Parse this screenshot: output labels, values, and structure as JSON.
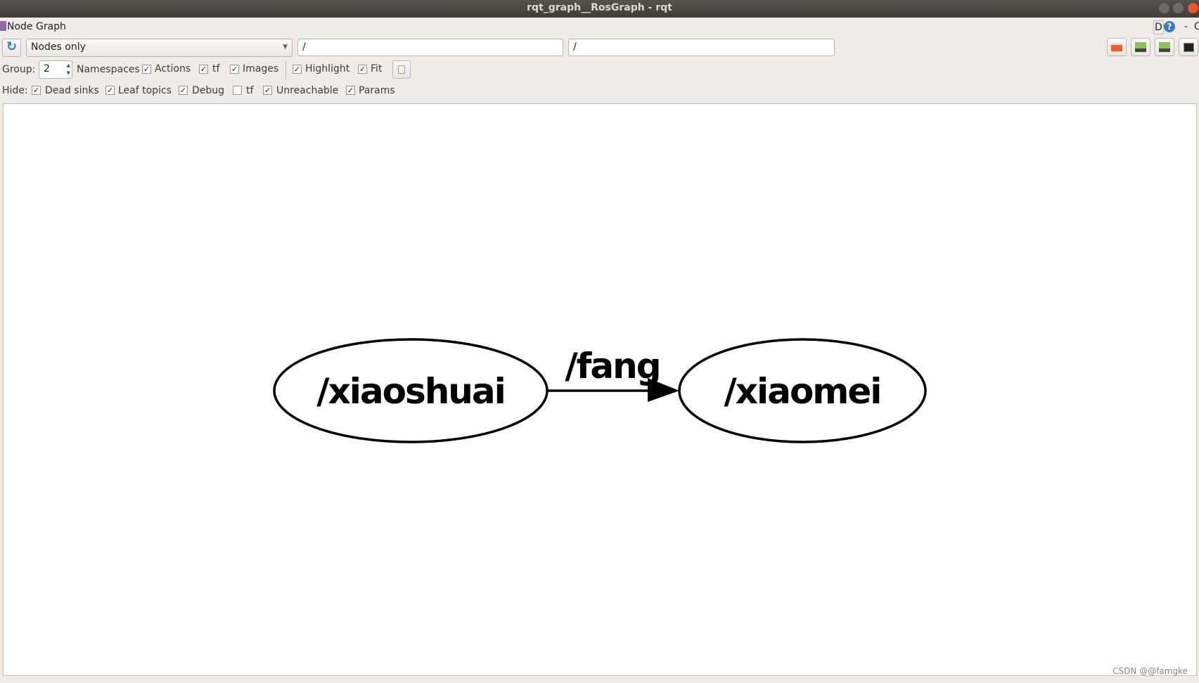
{
  "window": {
    "title": "rqt_graph__RosGraph - rqt"
  },
  "plugin": {
    "title": "Node Graph",
    "d_label": "D",
    "help_icon": "help-icon",
    "minus_label": "-",
    "o_label": "O"
  },
  "toolbar": {
    "refresh_icon": "refresh-icon",
    "mode": "Nodes only",
    "filter1": "/",
    "filter2": "/",
    "right_icons": [
      "open-folder-icon",
      "save-dot-icon",
      "save-image-icon",
      "screenshot-icon"
    ]
  },
  "group": {
    "label": "Group:",
    "value": "2",
    "namespaces": "Namespaces",
    "options": [
      {
        "label": "Actions",
        "checked": true
      },
      {
        "label": "tf",
        "checked": true
      },
      {
        "label": "Images",
        "checked": true
      },
      {
        "label": "Highlight",
        "checked": true
      },
      {
        "label": "Fit",
        "checked": true
      }
    ]
  },
  "hide": {
    "label": "Hide:",
    "options": [
      {
        "label": "Dead sinks",
        "checked": true
      },
      {
        "label": "Leaf topics",
        "checked": true
      },
      {
        "label": "Debug",
        "checked": true
      },
      {
        "label": "tf",
        "checked": false
      },
      {
        "label": "Unreachable",
        "checked": true
      },
      {
        "label": "Params",
        "checked": true
      }
    ]
  },
  "graph": {
    "nodes": [
      "/xiaoshuai",
      "/xiaomei"
    ],
    "edge": {
      "from": "/xiaoshuai",
      "to": "/xiaomei",
      "label": "/fang"
    }
  },
  "watermark": "CSDN @@famgke"
}
